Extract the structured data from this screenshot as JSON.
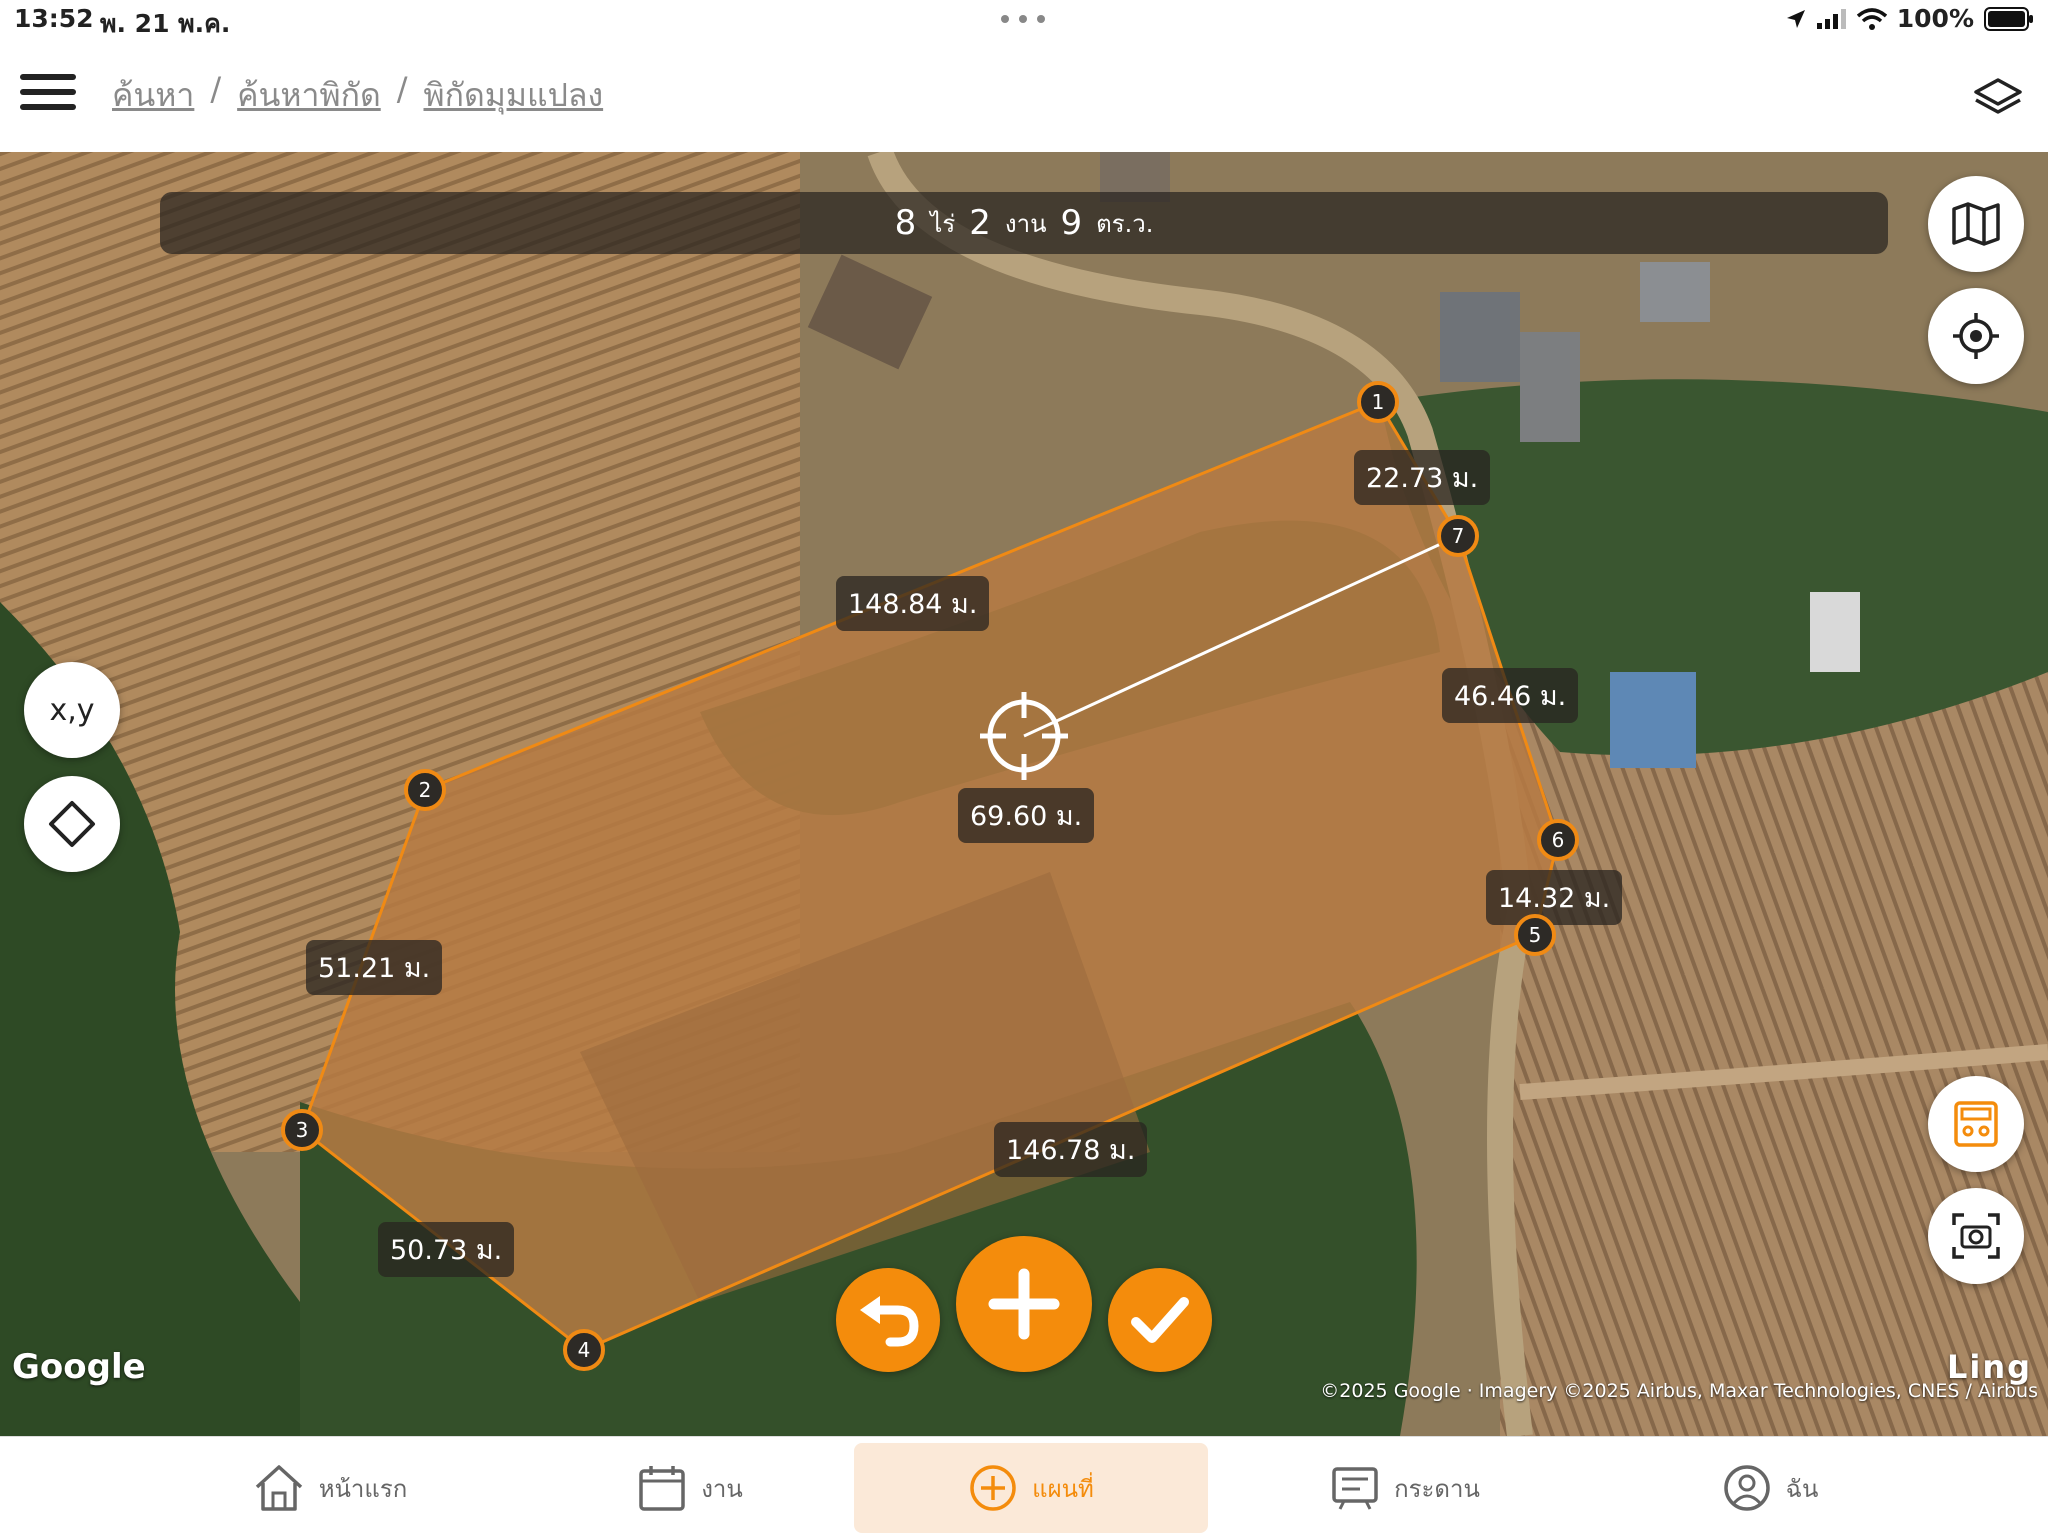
{
  "status_bar": {
    "time": "13:52",
    "date": "พ. 21 พ.ค.",
    "battery": "100%"
  },
  "header": {
    "breadcrumb": [
      "ค้นหา",
      "ค้นหาพิกัด",
      "พิกัดมุมแปลง"
    ],
    "separator": "/"
  },
  "area": {
    "rai": "8",
    "rai_unit": "ไร่",
    "ngan": "2",
    "ngan_unit": "งาน",
    "wa": "9",
    "wa_unit": "ตร.ว."
  },
  "map_buttons": {
    "xy_label": "x,y"
  },
  "vertices": [
    "1",
    "2",
    "3",
    "4",
    "5",
    "6",
    "7"
  ],
  "distances": {
    "d12": "148.84 ม.",
    "d23": "51.21 ม.",
    "d34": "50.73 ม.",
    "d45": "146.78 ม.",
    "d56": "14.32 ม.",
    "d67": "46.46 ม.",
    "d71": "22.73 ม.",
    "center": "69.60 ม."
  },
  "map_footer": {
    "logo": "Google",
    "attribution": "©2025 Google · Imagery ©2025 Airbus, Maxar Technologies, CNES / Airbus",
    "watermark": "Ling"
  },
  "tabs": [
    {
      "label": "หน้าแรก",
      "icon": "home-icon"
    },
    {
      "label": "งาน",
      "icon": "calendar-icon"
    },
    {
      "label": "แผนที่",
      "icon": "plus-circle-icon",
      "active": true
    },
    {
      "label": "กระดาน",
      "icon": "board-icon"
    },
    {
      "label": "ฉัน",
      "icon": "user-icon"
    }
  ],
  "colors": {
    "accent": "#f48c0c",
    "polygon": "#f08a14",
    "active_tab_bg": "#fbe9d8"
  }
}
